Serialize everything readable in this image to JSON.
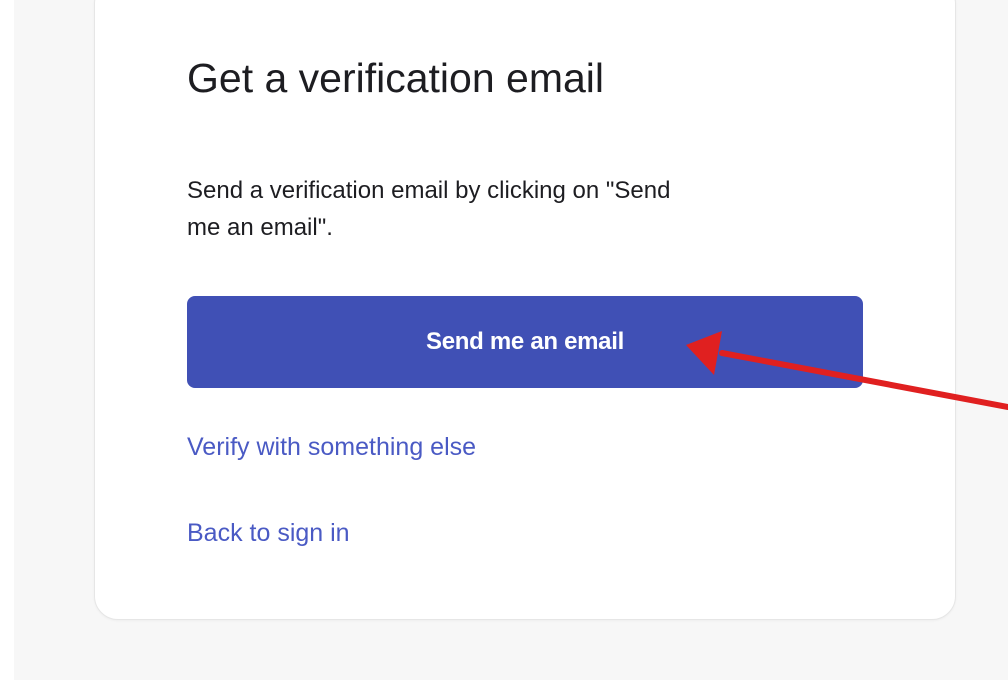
{
  "page": {
    "title": "Get a verification email",
    "description_lines": [
      "Send a verification email by clicking on \"Send",
      "me an email\"."
    ],
    "send_button_label": "Send me an email",
    "verify_else_link": "Verify with something else",
    "back_link": "Back to sign in"
  },
  "colors": {
    "primary": "#4050b5",
    "link": "#4a5ac4",
    "annotation_arrow": "#e02020"
  },
  "icons": {
    "annotation": "red-arrow-annotation"
  }
}
